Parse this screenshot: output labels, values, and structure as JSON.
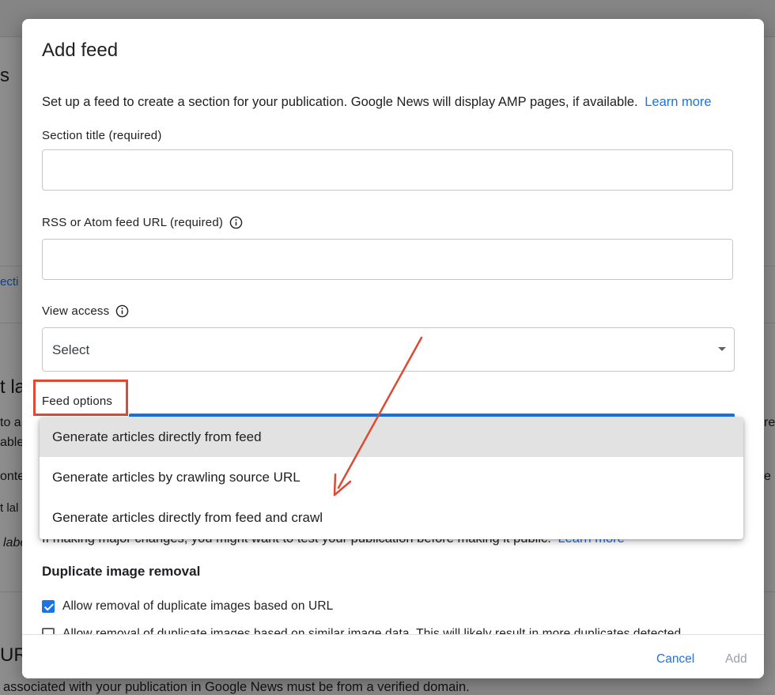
{
  "background": {
    "heading_fragment": "s",
    "tab_fragment": "ecti",
    "section_heading_fragment": "t la",
    "left_lines": [
      "to a",
      "able",
      "onte",
      "t lal",
      "label"
    ],
    "right_fragments": [
      "re",
      "e"
    ],
    "url_heading_fragment": "URL",
    "bottom_text": "associated with your publication in Google News must be from a verified domain."
  },
  "dialog": {
    "title": "Add feed",
    "description": "Set up a feed to create a section for your publication. Google News will display AMP pages, if available.",
    "learn_more": "Learn more",
    "section_title": {
      "label": "Section title (required)",
      "value": "",
      "placeholder": ""
    },
    "feed_url": {
      "label": "RSS or Atom feed URL (required)",
      "value": "",
      "placeholder": ""
    },
    "view_access": {
      "label": "View access",
      "value": "Select"
    },
    "feed_options": {
      "label": "Feed options",
      "options": [
        "Generate articles directly from feed",
        "Generate articles by crawling source URL",
        "Generate articles directly from feed and crawl"
      ],
      "highlighted_index": 0
    },
    "hint": "If making major changes, you might want to test your publication before making it public.",
    "hint_link": "Learn more",
    "duplicate_image_removal": {
      "heading": "Duplicate image removal",
      "options": [
        {
          "label": "Allow removal of duplicate images based on URL",
          "checked": true
        },
        {
          "label": "Allow removal of duplicate images based on similar image data. This will likely result in more duplicates detected.",
          "checked": false
        }
      ]
    },
    "footer": {
      "cancel": "Cancel",
      "add": "Add"
    }
  },
  "colors": {
    "accent": "#1a73e8",
    "annotation": "#dc4b33",
    "menu_highlight": "#e2e2e2",
    "disabled_text": "#9aa0a6"
  }
}
